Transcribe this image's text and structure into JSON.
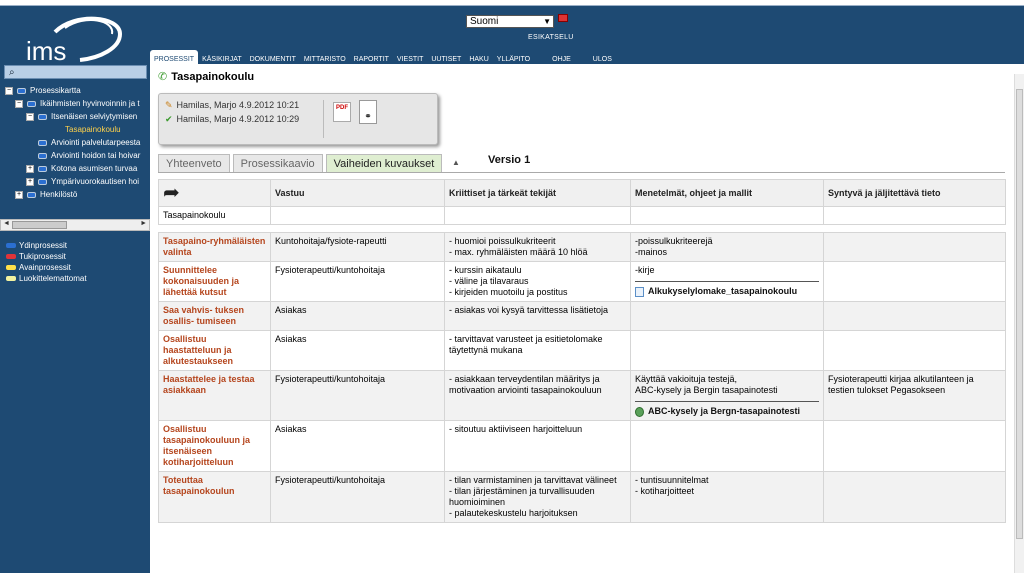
{
  "header": {
    "logo_text": "ims",
    "language": "Suomi",
    "preview": "ESIKATSELU",
    "nav": [
      "PROSESSIT",
      "KÄSIKIRJAT",
      "DOKUMENTIT",
      "MITTARISTO",
      "RAPORTIT",
      "VIESTIT",
      "UUTISET",
      "HAKU",
      "YLLÄPITO",
      "OHJE",
      "ULOS"
    ]
  },
  "sidebar": {
    "tree": [
      {
        "label": "Prosessikartta",
        "toggle": "−",
        "flag": "blue"
      },
      {
        "label": "Ikäihmisten hyvinvoinnin ja t",
        "toggle": "−",
        "flag": "blue"
      },
      {
        "label": "Itsenäisen selviytymisen",
        "toggle": "−",
        "flag": "blue"
      },
      {
        "label": "Tasapainokoulu",
        "toggle": "",
        "flag": "yellow"
      },
      {
        "label": "Arviointi palvelutarpeesta",
        "toggle": "",
        "flag": "blue"
      },
      {
        "label": "Arviointi hoidon tai hoivar",
        "toggle": "",
        "flag": "blue"
      },
      {
        "label": "Kotona asumisen turvaa",
        "toggle": "+",
        "flag": "blue"
      },
      {
        "label": "Ympärivuorokautisen hoi",
        "toggle": "+",
        "flag": "blue"
      },
      {
        "label": "Henkilöstö",
        "toggle": "+",
        "flag": "blue"
      }
    ],
    "legend": [
      {
        "label": "Ydinprosessit",
        "color": "#2b6fd1"
      },
      {
        "label": "Tukiprosessit",
        "color": "#e0343a"
      },
      {
        "label": "Avainprosessit",
        "color": "#ffe04a"
      },
      {
        "label": "Luokittelemattomat",
        "color": "#f2f2a0"
      }
    ]
  },
  "main": {
    "title": "Tasapainokoulu",
    "history": [
      "Hamilas, Marjo 4.9.2012 10:21",
      "Hamilas, Marjo 4.9.2012 10:29"
    ],
    "pdf_label": "PDF",
    "tabs": [
      "Yhteenveto",
      "Prosessikaavio",
      "Vaiheiden kuvaukset"
    ],
    "version": "Versio 1",
    "columns": [
      "Vastuu",
      "Kriittiset ja tärkeät tekijät",
      "Menetelmät, ohjeet ja mallit",
      "Syntyvä ja jäljitettävä tieto"
    ],
    "first_row_label": "Tasapainokoulu",
    "rows": [
      {
        "phase": "Tasapaino-ryhmäläisten valinta",
        "resp": "Kuntohoitaja/fysiote-rapeutti",
        "crit": [
          "- huomioi poissulkukriteerit",
          "- max. ryhmäläisten määrä 10 hlöä"
        ],
        "methods": [
          "-poissulkukriteerejä",
          "-mainos"
        ],
        "link": "",
        "link_icon": "",
        "info": ""
      },
      {
        "phase": "Suunnittelee kokonaisuuden ja lähettää kutsut",
        "resp": "Fysioterapeutti/kuntohoitaja",
        "crit": [
          "- kurssin aikataulu",
          "- väline ja tilavaraus",
          "- kirjeiden muotoilu ja postitus"
        ],
        "methods": [
          "-kirje"
        ],
        "link": "Alkukyselylomake_tasapainokoulu",
        "link_icon": "doc",
        "info": ""
      },
      {
        "phase": "Saa vahvis- tuksen osallis- tumiseen",
        "resp": "Asiakas",
        "crit": [
          "- asiakas voi kysyä tarvittessa lisätietoja"
        ],
        "methods": [],
        "link": "",
        "link_icon": "",
        "info": ""
      },
      {
        "phase": "Osallistuu haastatteluun ja alkutestaukseen",
        "resp": "Asiakas",
        "crit": [
          "- tarvittavat varusteet ja esitietolomake täytettynä mukana"
        ],
        "methods": [],
        "link": "",
        "link_icon": "",
        "info": ""
      },
      {
        "phase": "Haastattelee ja testaa asiakkaan",
        "resp": "Fysioterapeutti/kuntohoitaja",
        "crit": [
          "- asiakkaan terveydentilan määritys ja motivaation arviointi tasapainokouluun"
        ],
        "methods": [
          "Käyttää vakioituja testejä,",
          "ABC-kysely ja Bergin tasapainotesti"
        ],
        "link": "ABC-kysely ja Bergn-tasapainotesti",
        "link_icon": "globe",
        "info": "Fysioterapeutti kirjaa alkutilanteen ja testien tulokset Pegasokseen"
      },
      {
        "phase": "Osallistuu tasapainokouluun ja itsenäiseen kotiharjoitteluun",
        "resp": "Asiakas",
        "crit": [
          "- sitoutuu aktiiviseen harjoitteluun"
        ],
        "methods": [],
        "link": "",
        "link_icon": "",
        "info": ""
      },
      {
        "phase": "Toteuttaa tasapainokoulun",
        "resp": "Fysioterapeutti/kuntohoitaja",
        "crit": [
          "- tilan varmistaminen ja tarvittavat välineet",
          "- tilan järjestäminen ja turvallisuuden huomioiminen",
          "- palautekeskustelu harjoituksen"
        ],
        "methods": [
          "- tuntisuunnitelmat",
          "- kotiharjoitteet"
        ],
        "link": "",
        "link_icon": "",
        "info": ""
      }
    ]
  }
}
